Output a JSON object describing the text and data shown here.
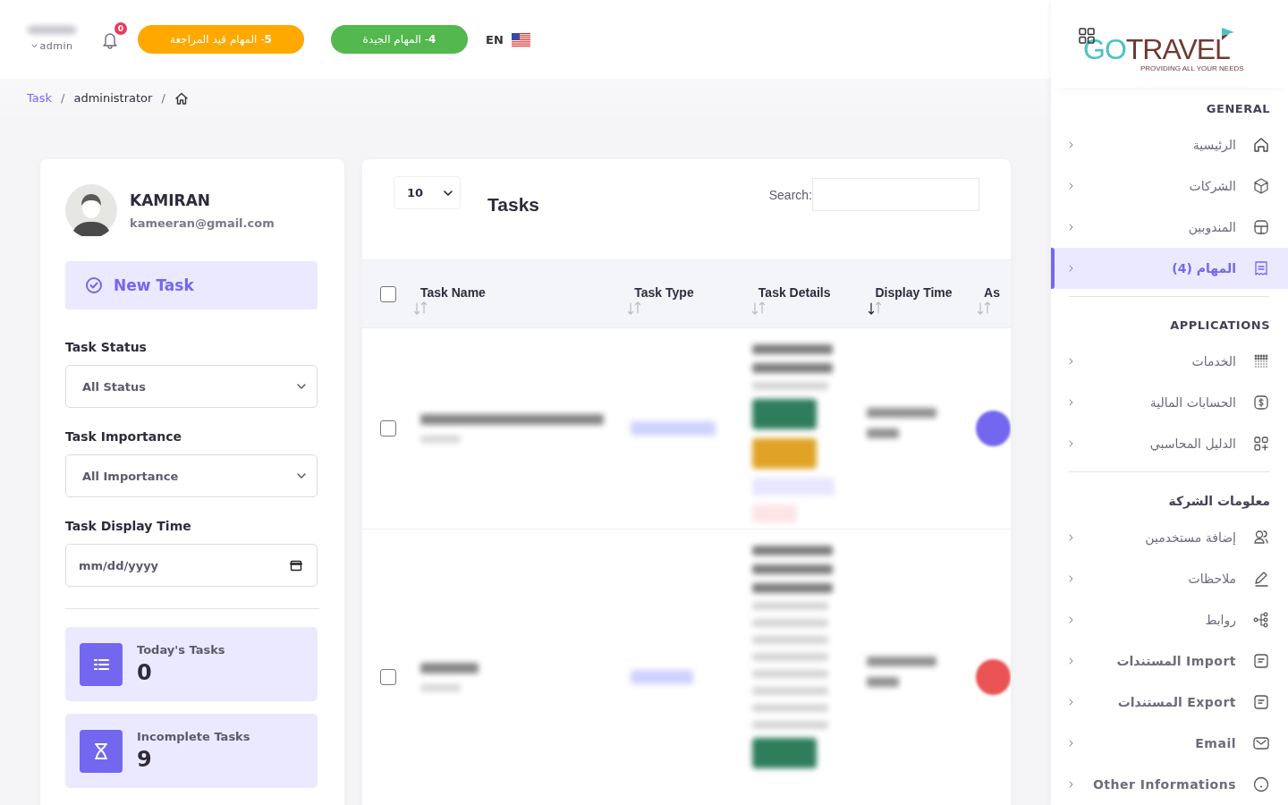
{
  "header": {
    "user_role": "admin",
    "notifications": "0",
    "pills": [
      {
        "text": "**4** - المهام الجيدة",
        "color": "#53b84d"
      },
      {
        "text": "**5** - المهام قيد المراجعة",
        "color": "#fea800"
      }
    ],
    "language": "EN"
  },
  "breadcrumb": [
    {
      "text": "administrator",
      "link": false,
      "separator": "/"
    },
    {
      "text": "Task",
      "link": true,
      "separator": "/"
    }
  ],
  "profile": {
    "name": "KAMIRAN",
    "email": "kameeran@gmail.com"
  },
  "new_task_button": "New Task",
  "filters": [
    {
      "label": "Task Status",
      "kind": "select",
      "value": "All Status"
    },
    {
      "label": "Task Importance",
      "kind": "select",
      "value": "All Importance"
    },
    {
      "label": "Task Display Time",
      "kind": "date",
      "placeholder": "mm/dd/yyyy"
    }
  ],
  "stats": [
    {
      "label": "Today's Tasks",
      "value": "0"
    },
    {
      "label": "Incomplete Tasks",
      "value": "9"
    }
  ],
  "table": {
    "page_size": "10",
    "title": "Tasks",
    "search_label": "Search:",
    "select_all_checked": false,
    "columns": [
      {
        "label": "As",
        "sorted": false
      },
      {
        "label": "Display Time",
        "sorted": true
      },
      {
        "label": "Task Details",
        "sorted": false
      },
      {
        "label": "Task Type",
        "sorted": false
      },
      {
        "label": "Task Name",
        "sorted": false
      }
    ],
    "rows": [
      {
        "checked": false,
        "color": "#7367f0"
      },
      {
        "checked": false,
        "color": "#ea5455"
      }
    ]
  },
  "sidebar": {
    "logo": {
      "word_1": "GO",
      "word_2": "TRAVEL",
      "tagline": "PROVIDING ALL YOUR NEEDS"
    },
    "sections": [
      {
        "title": "GENERAL",
        "items": [
          {
            "label": "الرئيسية",
            "selected": false
          },
          {
            "label": "الشركات",
            "selected": false
          },
          {
            "label": "المندوبين",
            "selected": false
          },
          {
            "label": "المهام (4)",
            "selected": true
          }
        ]
      },
      {
        "title": "APPLICATIONS",
        "items": [
          {
            "label": "الخدمات",
            "selected": false
          },
          {
            "label": "الحسابات المالية",
            "selected": false
          },
          {
            "label": "الدليل المحاسبي",
            "selected": false
          }
        ]
      },
      {
        "title": "معلومات الشركة",
        "items": [
          {
            "label": "إضافة مستخدمين",
            "selected": false
          },
          {
            "label": "ملاحظات",
            "selected": false
          },
          {
            "label": "روابط",
            "selected": false
          },
          {
            "label": "Import المستندات",
            "selected": false
          },
          {
            "label": "Export المستندات",
            "selected": false
          },
          {
            "label": "Email",
            "selected": false
          },
          {
            "label": "Other Informations",
            "selected": false
          }
        ]
      }
    ]
  }
}
